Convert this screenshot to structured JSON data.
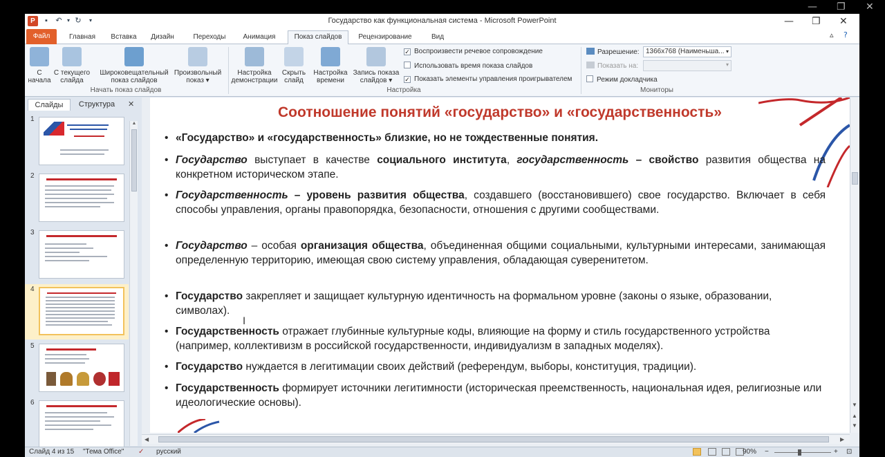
{
  "window": {
    "title": "Государство как функциональная система - Microsoft PowerPoint",
    "app_letter": "P"
  },
  "tabs": [
    {
      "label": "Файл"
    },
    {
      "label": "Главная"
    },
    {
      "label": "Вставка"
    },
    {
      "label": "Дизайн"
    },
    {
      "label": "Переходы"
    },
    {
      "label": "Анимация"
    },
    {
      "label": "Показ слайдов"
    },
    {
      "label": "Рецензирование"
    },
    {
      "label": "Вид"
    }
  ],
  "ribbon": {
    "group_start": {
      "label": "Начать показ слайдов",
      "buttons": [
        {
          "line1": "С",
          "line2": "начала"
        },
        {
          "line1": "С текущего",
          "line2": "слайда"
        },
        {
          "line1": "Широковещательный",
          "line2": "показ слайдов"
        },
        {
          "line1": "Произвольный",
          "line2": "показ ▾"
        }
      ]
    },
    "group_setup": {
      "label": "Настройка",
      "buttons": [
        {
          "line1": "Настройка",
          "line2": "демонстрации"
        },
        {
          "line1": "Скрыть",
          "line2": "слайд"
        },
        {
          "line1": "Настройка",
          "line2": "времени"
        },
        {
          "line1": "Запись показа",
          "line2": "слайдов ▾"
        }
      ],
      "checkboxes": [
        {
          "label": "Воспроизвести речевое сопровождение",
          "checked": "✓"
        },
        {
          "label": "Использовать время показа слайдов",
          "checked": ""
        },
        {
          "label": "Показать элементы управления проигрывателем",
          "checked": "✓"
        }
      ]
    },
    "group_monitors": {
      "label": "Мониторы",
      "resolution_label": "Разрешение:",
      "resolution_value": "1366x768 (Наименьша...",
      "show_on_label": "Показать на:",
      "presenter_mode": "Режим докладчика"
    }
  },
  "left_pane": {
    "tab_slides": "Слайды",
    "tab_outline": "Структура",
    "thumbnails": [
      {
        "num": "1"
      },
      {
        "num": "2"
      },
      {
        "num": "3"
      },
      {
        "num": "4"
      },
      {
        "num": "5"
      },
      {
        "num": "6"
      }
    ]
  },
  "slide": {
    "title": "Соотношение понятий «государство» и «государственность»",
    "b1": {
      "t": "«Государство» и «государственность» близкие, но не тождественные понятия."
    },
    "b2": {
      "a": "Государство",
      "b": " выступает в качестве ",
      "c": "социального института",
      "d": ", ",
      "e": "государственность",
      "f": " – свойство",
      "g": " развития общества на конкретном историческом этапе."
    },
    "b3": {
      "a": "Государственность",
      "b": " – уровень развития общества",
      "c": ", создавшего (восстановившего) свое государство. Включает в себя способы управления, органы правопорядка, безопасности, отношения с другими сообществами."
    },
    "b4": {
      "a": "Государство",
      "b": " – особая ",
      "c": "организация общества",
      "d": ", объединенная общими социальными, культурными интересами, занимающая определенную территорию, имеющая свою систему управления, обладающая суверенитетом."
    },
    "b5": {
      "a": "Государство",
      "b": " закрепляет и защищает культурную идентичность на формальном уровне (законы о языке, образовании, символах)."
    },
    "b6": {
      "a": "Государственность",
      "b": " отражает глубинные культурные коды, влияющие на форму и стиль государственного устройства (например, коллективизм в российской государственности, индивидуализм в западных моделях)."
    },
    "b7": {
      "a": "Государство",
      "b": " нуждается в легитимации своих действий (референдум, выборы, конституция, традиции)."
    },
    "b8": {
      "a": "Государственность",
      "b": " формирует источники легитимности (историческая преемственность, национальная идея, религиозные или идеологические основы)."
    }
  },
  "status": {
    "slide_of": "Слайд 4 из 15",
    "theme": "\"Тема Office\"",
    "language": "русский",
    "zoom": "90%"
  },
  "colors": {
    "accent": "#e2602b",
    "title_red": "#c0392b"
  }
}
